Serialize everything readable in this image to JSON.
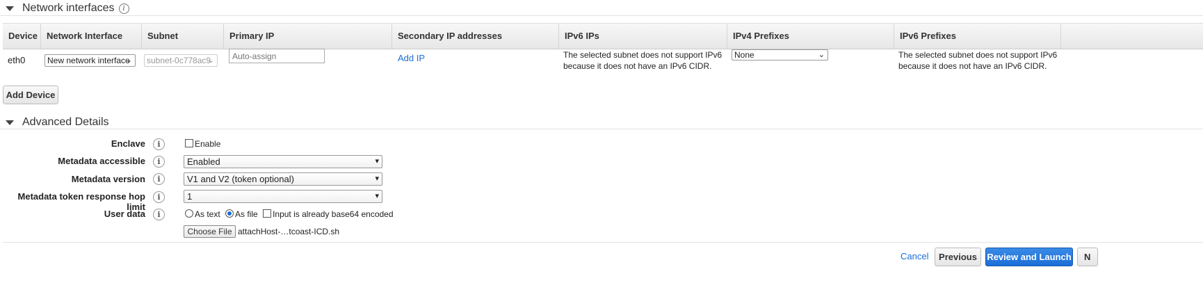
{
  "network": {
    "title": "Network interfaces",
    "columns": [
      "Device",
      "Network Interface",
      "Subnet",
      "Primary IP",
      "Secondary IP addresses",
      "IPv6 IPs",
      "IPv4 Prefixes",
      "IPv6 Prefixes"
    ],
    "row": {
      "device": "eth0",
      "interface": "New network interface",
      "subnet": "subnet-0c778ac9",
      "primary_ip_placeholder": "Auto-assign",
      "secondary_link": "Add IP",
      "ipv6_ips": "The selected subnet does not support IPv6 because it does not have an IPv6 CIDR.",
      "ipv4_prefixes": "None",
      "ipv6_prefixes": "The selected subnet does not support IPv6 because it does not have an IPv6 CIDR."
    },
    "add_device": "Add Device"
  },
  "advanced": {
    "title": "Advanced Details",
    "enclave_label": "Enclave",
    "enclave_option": "Enable",
    "metadata_accessible_label": "Metadata accessible",
    "metadata_accessible_value": "Enabled",
    "metadata_version_label": "Metadata version",
    "metadata_version_value": "V1 and V2 (token optional)",
    "hop_limit_label": "Metadata token response hop limit",
    "hop_limit_value": "1",
    "user_data_label": "User data",
    "as_text": "As text",
    "as_file": "As file",
    "base64": "Input is already base64 encoded",
    "choose_file": "Choose File",
    "file_name": "attachHost-…tcoast-ICD.sh"
  },
  "footer": {
    "cancel": "Cancel",
    "previous": "Previous",
    "review": "Review and Launch",
    "next_partial": "N"
  },
  "colors": {
    "primary": "#1a6ed8",
    "link": "#1a6ed8"
  }
}
